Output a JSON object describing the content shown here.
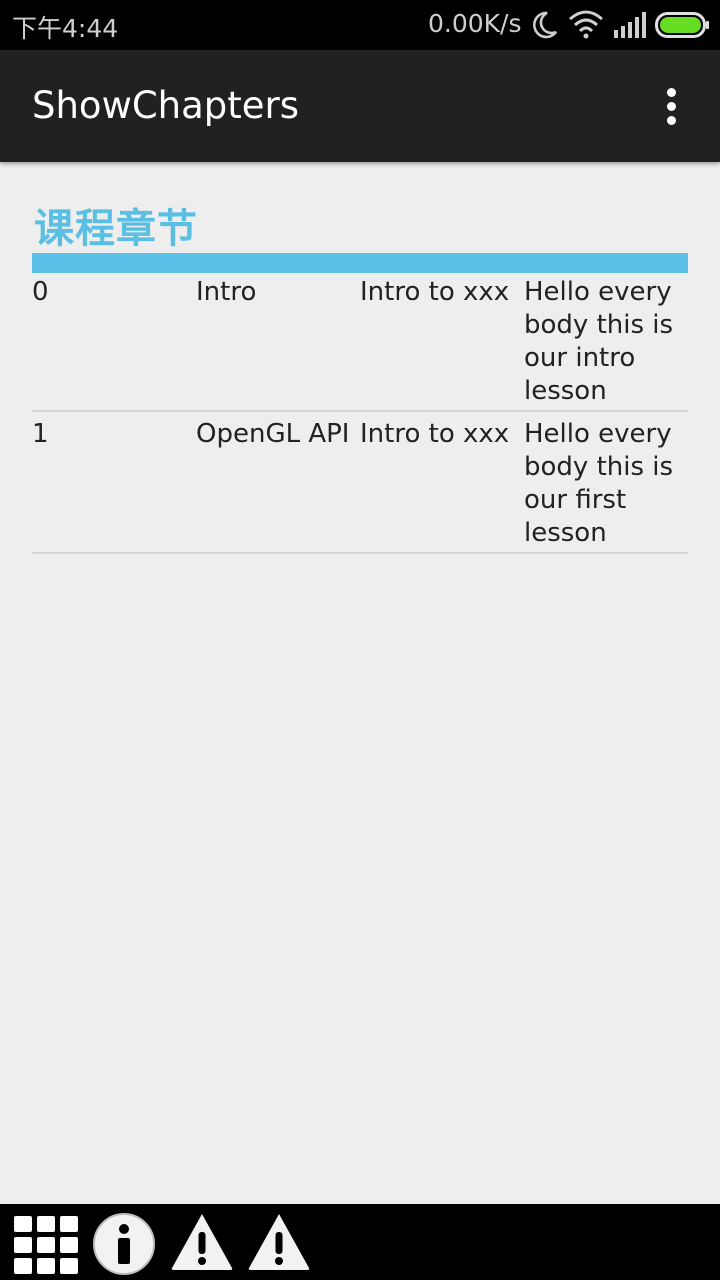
{
  "status_bar": {
    "time": "下午4:44",
    "net_speed": "0.00K/s"
  },
  "action_bar": {
    "title": "ShowChapters"
  },
  "content": {
    "section_title": "课程章节",
    "chapters": [
      {
        "index": "0",
        "name": "Intro",
        "subtitle": "Intro to xxx",
        "description": "Hello every body this is our intro lesson"
      },
      {
        "index": "1",
        "name": "OpenGL API",
        "subtitle": "Intro to xxx",
        "description": "Hello every body this is our first lesson"
      }
    ]
  },
  "colors": {
    "accent": "#5bc0e8",
    "action_bar": "#212121",
    "status_bar": "#000000",
    "background": "#eeeeee",
    "battery": "#66dd22"
  },
  "icons": [
    "moon-icon",
    "wifi-icon",
    "signal-icon",
    "battery-icon",
    "overflow-menu-icon",
    "grid-icon",
    "info-icon",
    "warning-icon"
  ]
}
